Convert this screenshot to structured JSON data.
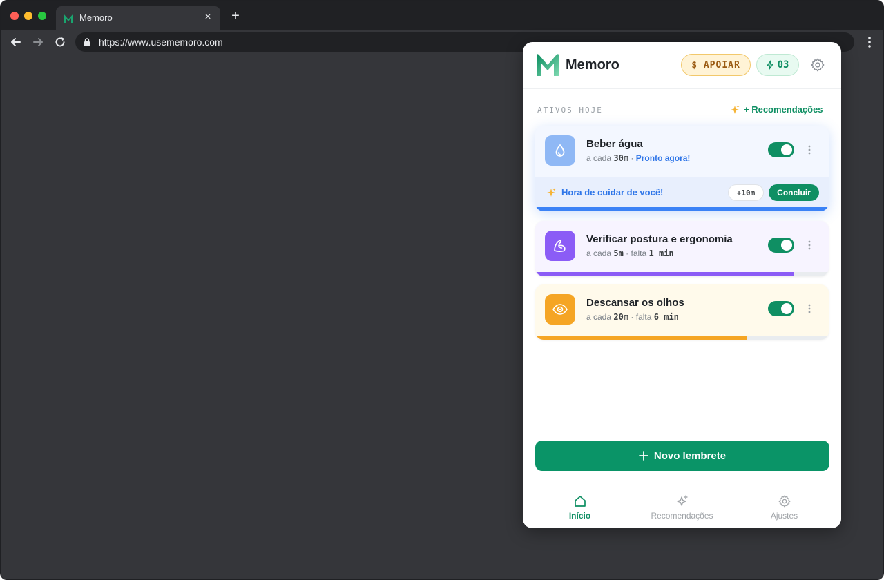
{
  "browser": {
    "tab_title": "Memoro",
    "tab_close": "×",
    "new_tab": "+",
    "url": "https://www.usememoro.com"
  },
  "header": {
    "brand": "Memoro",
    "support_label": "$ APOIAR",
    "streak_count": "03"
  },
  "section": {
    "label": "ATIVOS HOJE",
    "reco_link": "+ Recomendações"
  },
  "reminders": [
    {
      "title": "Beber água",
      "prefix": "a cada",
      "interval": "30m",
      "sep": "·",
      "status": "Pronto agora!",
      "enabled": true,
      "action_text": "Hora de cuidar de você!",
      "snooze_label": "+10m",
      "done_label": "Concluir",
      "progress": 1.0,
      "color": "#3b82f6"
    },
    {
      "title": "Verificar postura e ergonomia",
      "prefix": "a cada",
      "interval": "5m",
      "sep": "· falta",
      "remaining": "1 min",
      "enabled": true,
      "progress": 0.88,
      "color": "#8b5cf6"
    },
    {
      "title": "Descansar os olhos",
      "prefix": "a cada",
      "interval": "20m",
      "sep": "· falta",
      "remaining": "6 min",
      "enabled": true,
      "progress": 0.72,
      "color": "#f5a524"
    }
  ],
  "new_reminder_label": "Novo lembrete",
  "nav": {
    "home": "Início",
    "recommendations": "Recomendações",
    "settings": "Ajustes"
  },
  "colors": {
    "accent": "#0f8f63",
    "blue": "#2f76e8"
  }
}
